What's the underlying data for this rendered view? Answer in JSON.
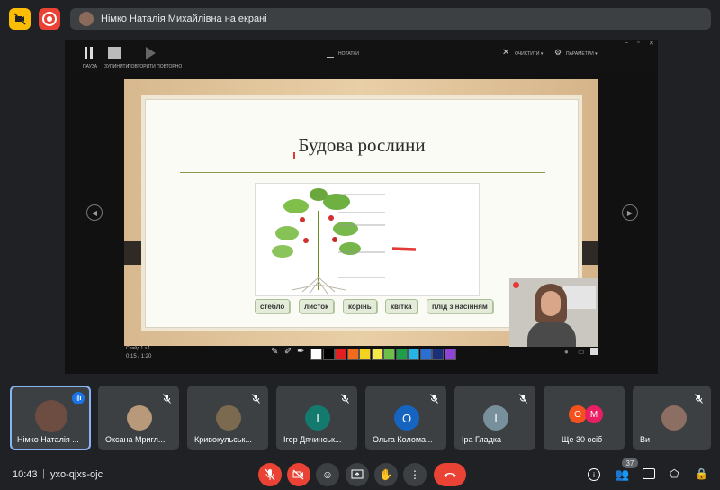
{
  "top": {
    "presenting_text": "Німко Наталія Михайлівна на екрані"
  },
  "ppt": {
    "pause_label": "ПАУЗА",
    "stop_label": "ЗУПИНИТИ",
    "repeat_label": "ПОВТОРИТИ ПОВТОРНО",
    "notes_label": "НОТАТКИ",
    "clear_label": "ОЧИСТИТИ ▾",
    "settings_label": "ПАРАМЕТРИ ▾",
    "slide_counter": "Слайд 1 з 1",
    "timer": "0:15 / 1:20"
  },
  "slide": {
    "title": "Будова рослини",
    "labels": [
      "стебло",
      "листок",
      "корінь",
      "квітка",
      "плід з насінням"
    ]
  },
  "ink_colors": [
    "#ffffff",
    "#000000",
    "#e02020",
    "#f26b1d",
    "#f5d21e",
    "#f5e94a",
    "#6cc04a",
    "#1f9e4a",
    "#27b4e8",
    "#2a6fd8",
    "#1b2f7a",
    "#8e44d6"
  ],
  "participants": [
    {
      "name": "Німко Наталія ...",
      "initial": "",
      "color": "#6d4c41",
      "active": true,
      "muted": false
    },
    {
      "name": "Оксана Мригл...",
      "initial": "",
      "color": "#b89a7a",
      "active": false,
      "muted": true
    },
    {
      "name": "Кривокульськ...",
      "initial": "",
      "color": "#7b6a50",
      "active": false,
      "muted": true
    },
    {
      "name": "Ігор Дячинськ...",
      "initial": "І",
      "color": "#137a6e",
      "active": false,
      "muted": true
    },
    {
      "name": "Ольга Колома...",
      "initial": "О",
      "color": "#1565c0",
      "active": false,
      "muted": true
    },
    {
      "name": "Іра Гладка",
      "initial": "І",
      "color": "#78909c",
      "active": false,
      "muted": true
    },
    {
      "name": "Ще 30 осіб",
      "initial": "",
      "color": "",
      "active": false,
      "muted": false
    },
    {
      "name": "Ви",
      "initial": "",
      "color": "#8d6e63",
      "active": false,
      "muted": true
    }
  ],
  "more": {
    "initial_a": "О",
    "initial_b": "М",
    "color_a": "#f4511e",
    "color_b": "#e91e63"
  },
  "bottom": {
    "time": "10:43",
    "separator": "|",
    "meeting_code": "yxo-qjxs-ojc",
    "people_count": "37"
  },
  "colors": {
    "danger": "#ea4335",
    "accent": "#8ab4f8",
    "bg": "#202124",
    "tile": "#3c4043"
  }
}
